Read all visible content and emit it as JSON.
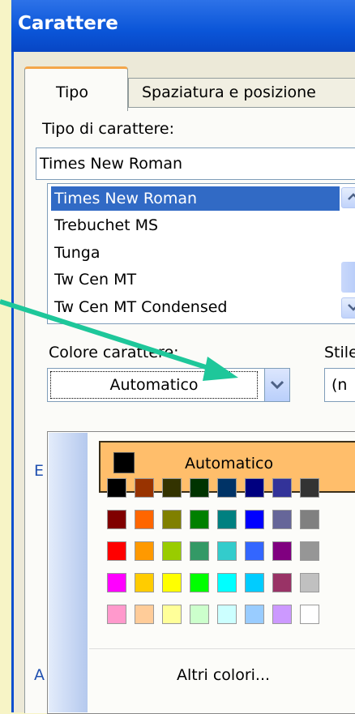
{
  "window": {
    "title": "Carattere"
  },
  "tabs": [
    {
      "label": "Tipo",
      "active": true
    },
    {
      "label": "Spaziatura e posizione",
      "active": false
    }
  ],
  "font": {
    "label": "Tipo di carattere:",
    "value": "Times New Roman",
    "list": [
      "Times New Roman",
      "Trebuchet MS",
      "Tunga",
      "Tw Cen MT",
      "Tw Cen MT Condensed"
    ],
    "selected_index": 0
  },
  "color": {
    "label": "Colore carattere:",
    "value": "Automatico"
  },
  "style": {
    "label": "Stile",
    "value": "(n"
  },
  "side_letters": {
    "e": "E",
    "a": "A"
  },
  "palette": {
    "automatic_label": "Automatico",
    "more_colors_label": "Altri colori...",
    "rows": [
      [
        "#000000",
        "#993300",
        "#333300",
        "#003300",
        "#003366",
        "#000080",
        "#333399",
        "#333333"
      ],
      [
        "#800000",
        "#ff6600",
        "#808000",
        "#008000",
        "#008080",
        "#0000ff",
        "#666699",
        "#808080"
      ],
      [
        "#ff0000",
        "#ff9900",
        "#99cc00",
        "#339966",
        "#33cccc",
        "#3366ff",
        "#800080",
        "#969696"
      ],
      [
        "#ff00ff",
        "#ffcc00",
        "#ffff00",
        "#00ff00",
        "#00ffff",
        "#00ccff",
        "#993366",
        "#c0c0c0"
      ],
      [
        "#ff99cc",
        "#ffcc99",
        "#ffff99",
        "#ccffcc",
        "#ccffff",
        "#99ccff",
        "#cc99ff",
        "#ffffff"
      ]
    ]
  },
  "accent": {
    "title_bar": "#0a55d8",
    "selection": "#316ac5",
    "annotation_arrow": "#1ec79a"
  }
}
